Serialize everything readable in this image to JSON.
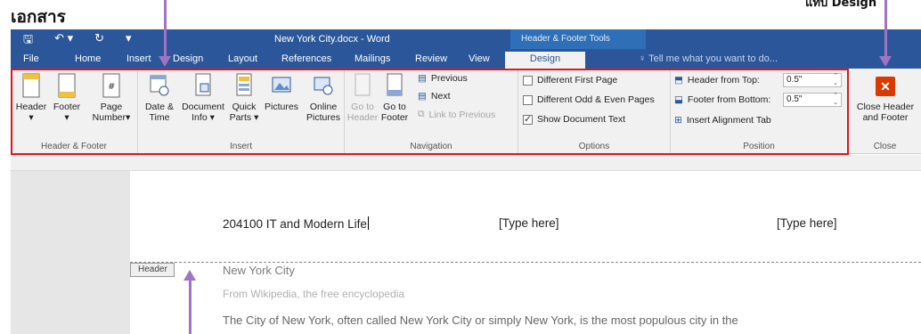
{
  "annotations": {
    "top_left": "เอกสาร",
    "top_right": "แท็บ Design"
  },
  "titlebar": {
    "doc_title": "New York City.docx - Word",
    "contextual_title": "Header & Footer Tools",
    "save_icon": "save-icon",
    "undo_icon": "undo-icon",
    "redo_icon": "redo-icon",
    "customize_icon": "customize-icon"
  },
  "tabs": [
    "File",
    "Home",
    "Insert",
    "Design",
    "Layout",
    "References",
    "Mailings",
    "Review",
    "View"
  ],
  "active_tab": "Design",
  "tell_me": "Tell me what you want to do...",
  "groups": {
    "header_footer": {
      "label": "Header & Footer",
      "header": "Header",
      "footer": "Footer",
      "page_number_1": "Page",
      "page_number_2": "Number",
      "dropdown": "▾"
    },
    "insert": {
      "label": "Insert",
      "date_time_1": "Date &",
      "date_time_2": "Time",
      "doc_info_1": "Document",
      "doc_info_2": "Info",
      "quick_parts_1": "Quick",
      "quick_parts_2": "Parts",
      "pictures": "Pictures",
      "online_pictures_1": "Online",
      "online_pictures_2": "Pictures",
      "dropdown": "▾"
    },
    "navigation": {
      "label": "Navigation",
      "goto_header_1": "Go to",
      "goto_header_2": "Header",
      "goto_footer_1": "Go to",
      "goto_footer_2": "Footer",
      "previous": "Previous",
      "next": "Next",
      "link_previous": "Link to Previous"
    },
    "options": {
      "label": "Options",
      "different_first": "Different First Page",
      "different_odd_even": "Different Odd & Even Pages",
      "show_doc_text": "Show Document Text",
      "show_doc_text_checked": true
    },
    "position": {
      "label": "Position",
      "header_from_top": "Header from Top:",
      "header_from_top_value": "0.5\"",
      "footer_from_bottom": "Footer from Bottom:",
      "footer_from_bottom_value": "0.5\"",
      "insert_alignment_tab": "Insert Alignment Tab"
    },
    "close": {
      "label": "Close",
      "close_1": "Close Header",
      "close_2": "and Footer",
      "x": "✕"
    }
  },
  "document": {
    "header_left": "204100 IT and Modern Life",
    "header_center": "[Type here]",
    "header_right": "[Type here]",
    "header_tag": "Header",
    "title": "New York City",
    "subtitle": "From Wikipedia, the free encyclopedia",
    "body": "The City of New York, often called New York City or simply New York, is the most populous city in the"
  },
  "colors": {
    "ribbon_blue": "#2b579a",
    "annotation_arrow": "#a074c4",
    "highlight_box": "#e0161b",
    "close_button": "#d83b01"
  }
}
